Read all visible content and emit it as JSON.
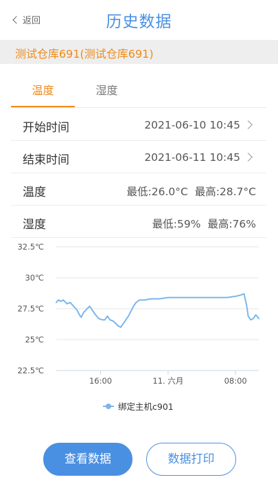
{
  "header": {
    "back_label": "返回",
    "title": "历史数据"
  },
  "warehouse": {
    "name": "测试仓库691(测试仓库691)"
  },
  "tabs": [
    {
      "label": "温度",
      "active": true
    },
    {
      "label": "湿度",
      "active": false
    }
  ],
  "rows": {
    "start": {
      "label": "开始时间",
      "value": "2021-06-10 10:45"
    },
    "end": {
      "label": "结束时间",
      "value": "2021-06-11 10:45"
    },
    "temperature": {
      "label": "温度",
      "value": "最低:26.0°C  最高:28.7°C"
    },
    "humidity": {
      "label": "湿度",
      "value": "最低:59%  最高:76%"
    }
  },
  "buttons": {
    "view": "查看数据",
    "print": "数据打印"
  },
  "colors": {
    "accent_blue": "#4a90e2",
    "accent_orange": "#ef8a17",
    "series": "#7cb5ec"
  },
  "chart_data": {
    "type": "line",
    "y_ticks": [
      "32.5℃",
      "30℃",
      "27.5℃",
      "25℃",
      "22.5℃"
    ],
    "y_tick_values": [
      32.5,
      30,
      27.5,
      25,
      22.5
    ],
    "ylim": [
      22.5,
      32.5
    ],
    "x_ticks": [
      "16:00",
      "11. 六月",
      "08:00"
    ],
    "x_tick_hours": [
      16,
      24,
      32
    ],
    "xlim_hours": [
      10.75,
      34.75
    ],
    "grid": true,
    "legend_position": "bottom",
    "series": [
      {
        "name": "绑定主机c901",
        "points": [
          [
            10.75,
            28.0
          ],
          [
            11.0,
            28.2
          ],
          [
            11.3,
            28.1
          ],
          [
            11.6,
            28.2
          ],
          [
            12.0,
            27.9
          ],
          [
            12.4,
            28.0
          ],
          [
            12.8,
            27.7
          ],
          [
            13.2,
            27.4
          ],
          [
            13.5,
            27.0
          ],
          [
            13.7,
            26.8
          ],
          [
            14.0,
            27.2
          ],
          [
            14.4,
            27.5
          ],
          [
            14.7,
            27.7
          ],
          [
            15.0,
            27.4
          ],
          [
            15.4,
            27.0
          ],
          [
            15.8,
            26.7
          ],
          [
            16.2,
            26.6
          ],
          [
            16.5,
            26.6
          ],
          [
            16.8,
            26.9
          ],
          [
            17.1,
            26.6
          ],
          [
            17.5,
            26.5
          ],
          [
            17.8,
            26.3
          ],
          [
            18.1,
            26.1
          ],
          [
            18.4,
            26.0
          ],
          [
            18.7,
            26.3
          ],
          [
            19.0,
            26.6
          ],
          [
            19.3,
            26.9
          ],
          [
            19.6,
            27.3
          ],
          [
            19.9,
            27.7
          ],
          [
            20.2,
            28.0
          ],
          [
            20.6,
            28.2
          ],
          [
            21.2,
            28.2
          ],
          [
            22.0,
            28.3
          ],
          [
            23.0,
            28.3
          ],
          [
            24.0,
            28.4
          ],
          [
            25.0,
            28.4
          ],
          [
            26.0,
            28.4
          ],
          [
            27.0,
            28.4
          ],
          [
            28.0,
            28.4
          ],
          [
            29.0,
            28.4
          ],
          [
            30.0,
            28.4
          ],
          [
            31.0,
            28.4
          ],
          [
            32.0,
            28.5
          ],
          [
            32.6,
            28.6
          ],
          [
            33.0,
            28.7
          ],
          [
            33.3,
            27.8
          ],
          [
            33.5,
            26.9
          ],
          [
            33.8,
            26.6
          ],
          [
            34.1,
            26.7
          ],
          [
            34.4,
            27.0
          ],
          [
            34.75,
            26.7
          ]
        ]
      }
    ]
  }
}
